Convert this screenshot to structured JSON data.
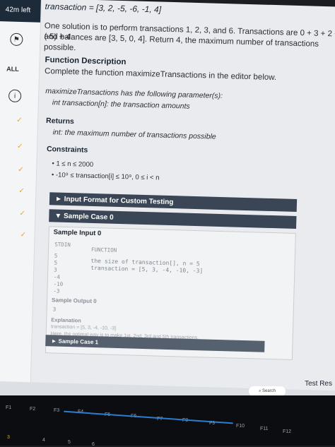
{
  "timer": "42m left",
  "sidebar": {
    "all_label": "ALL",
    "icon1": "flag-icon",
    "icon2": "info-icon"
  },
  "problem": {
    "transaction_line": "transaction = [3, 2, -5, -6, -1, 4]",
    "solution_line1": "One solution is to perform transactions 1, 2, 3, and 6. Transactions are 0 + 3 + 2 + (-5) + 4",
    "solution_line2": "and balances are [3, 5, 0, 4]. Return 4, the maximum number of transactions possible.",
    "func_desc_title": "Function Description",
    "func_desc_text": "Complete the function maximizeTransactions in the editor below.",
    "params_intro": "maximizeTransactions has the following parameter(s):",
    "params_item": "int transaction[n]: the transaction amounts",
    "returns_title": "Returns",
    "returns_text": "int: the maximum number of transactions possible",
    "constraints_title": "Constraints",
    "constraint1": "1 ≤ n ≤ 2000",
    "constraint2": "-10⁹ ≤ transaction[i] ≤ 10⁹, 0 ≤ i < n"
  },
  "sections": {
    "input_format": "► Input Format for Custom Testing",
    "sample_case0": "▼ Sample Case 0",
    "sample_input_title": "Sample Input 0",
    "stdin_header": "STDIN",
    "function_header": "FUNCTION",
    "stdin_values": [
      "5",
      "5",
      "3",
      "-4",
      "-10",
      "-3"
    ],
    "function_line1": "the size of transaction[], n = 5",
    "function_line2": "transaction = [5, 3, -4, -10, -3]",
    "sample_output_title": "Sample Output 0",
    "sample_output_value": "3",
    "explanation_title": "Explanation",
    "explanation_line1": "transaction = [5, 3, -4, -10, -3]",
    "explanation_line2": "Here, the optimal way is to make 1st, 2nd, 3rd and 5th transactions.",
    "sample_case1": "► Sample Case 1"
  },
  "bottom": {
    "test_results": "Test Res",
    "search": "Search"
  },
  "keyboard": {
    "fkeys": [
      "F1",
      "F2",
      "F3",
      "F4",
      "F5",
      "F6",
      "F7",
      "F8",
      "F9",
      "F10",
      "F11",
      "F12"
    ],
    "digits": [
      "3",
      "4",
      "5",
      "6"
    ]
  }
}
